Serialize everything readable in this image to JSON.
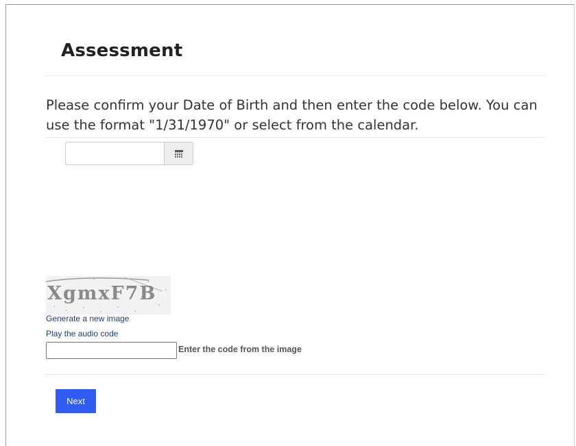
{
  "page": {
    "title": "Assessment",
    "instructions": "Please confirm your Date of Birth and then enter the code below. You can use the format \"1/31/1970\" or select from the calendar."
  },
  "dob": {
    "value": "",
    "calendar_icon": "calendar-icon"
  },
  "captcha": {
    "image_text": "XgmxF7B",
    "new_image_link": "Generate a new image",
    "audio_link": "Play the audio code",
    "code_value": "",
    "code_label": "Enter the code from the image"
  },
  "actions": {
    "next_label": "Next",
    "next_color": "#2f5cf2"
  }
}
